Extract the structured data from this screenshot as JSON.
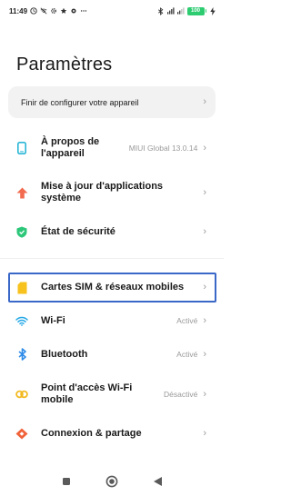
{
  "status_bar": {
    "time": "11:49",
    "battery": "100",
    "left_icons": [
      "clock-icon",
      "wifi-off-icon",
      "gear-icon",
      "star-icon",
      "settings-icon",
      "more-icon"
    ],
    "right_icons": [
      "bluetooth-icon",
      "signal-icon",
      "signal-icon"
    ]
  },
  "page": {
    "title": "Paramètres"
  },
  "setup_card": {
    "label": "Finir de configurer votre appareil"
  },
  "settings": [
    {
      "label": "À propos de l'appareil",
      "label_lines": [
        "À propos de",
        "l'appareil"
      ],
      "value": "MIUI Global 13.0.14",
      "icon": "phone-icon",
      "color": "#29b6d6"
    },
    {
      "label": "Mise à jour d'applications système",
      "label_lines": [
        "Mise à jour d'applications",
        "système"
      ],
      "value": "",
      "icon": "arrow-up-icon",
      "color": "#f26b4f"
    },
    {
      "label": "État de sécurité",
      "label_lines": [
        "État de sécurité"
      ],
      "value": "",
      "icon": "shield-check-icon",
      "color": "#2dc77a"
    },
    {
      "label": "Cartes SIM & réseaux mobiles",
      "label_lines": [
        "Cartes SIM & réseaux mobiles"
      ],
      "value": "",
      "icon": "sim-card-icon",
      "color": "#f7c21e"
    },
    {
      "label": "Wi-Fi",
      "label_lines": [
        "Wi-Fi"
      ],
      "value": "Activé",
      "icon": "wifi-icon",
      "color": "#27a9e6"
    },
    {
      "label": "Bluetooth",
      "label_lines": [
        "Bluetooth"
      ],
      "value": "Activé",
      "icon": "bluetooth-icon",
      "color": "#2f8ce8"
    },
    {
      "label": "Point d'accès Wi-Fi mobile",
      "label_lines": [
        "Point d'accès Wi-Fi",
        "mobile"
      ],
      "value": "Désactivé",
      "icon": "hotspot-icon",
      "color": "#f2b91f"
    },
    {
      "label": "Connexion & partage",
      "label_lines": [
        "Connexion & partage"
      ],
      "value": "",
      "icon": "share-icon",
      "color": "#f0623a"
    }
  ],
  "nav": {
    "recents_icon": "square-icon",
    "home_icon": "circle-icon",
    "back_icon": "triangle-back-icon"
  }
}
